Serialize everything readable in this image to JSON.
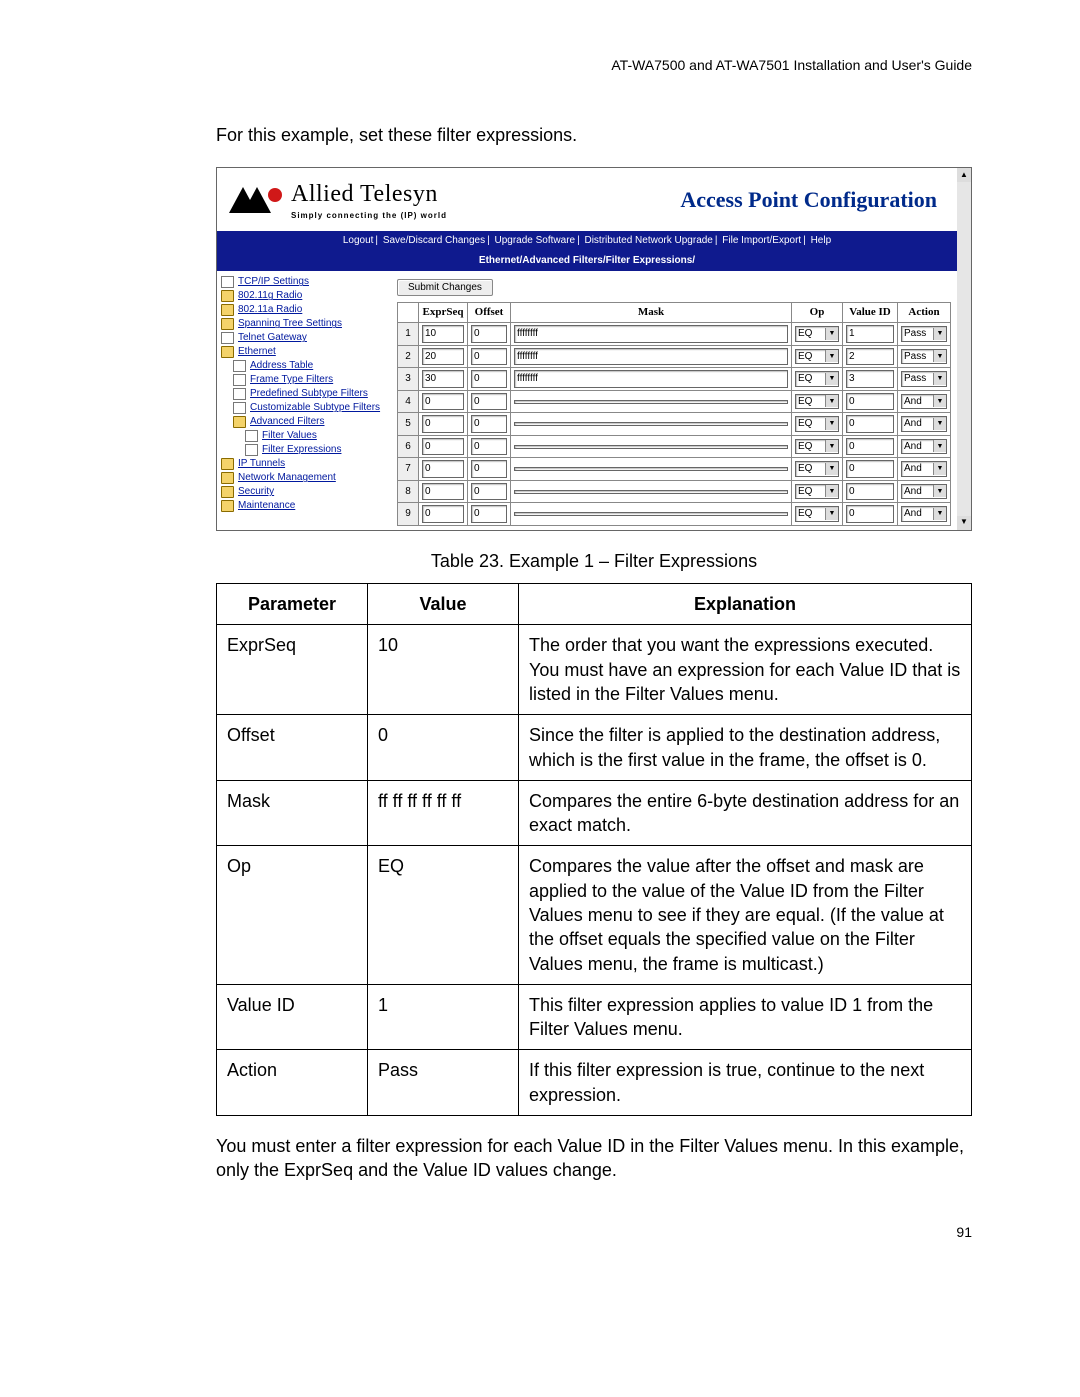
{
  "doc": {
    "running_head": "AT-WA7500 and AT-WA7501 Installation and User's Guide",
    "intro": "For this example, set these filter expressions.",
    "caption": "Table 23. Example 1 – Filter Expressions",
    "outro": "You must enter a filter expression for each Value ID in the Filter Values menu. In this example, only the ExprSeq and the Value ID values change.",
    "page_number": "91"
  },
  "screenshot": {
    "brand_name": "Allied Telesyn",
    "brand_tag": "Simply connecting the (IP) world",
    "title": "Access Point Configuration",
    "nav": {
      "links": [
        "Logout",
        "Save/Discard Changes",
        "Upgrade Software",
        "Distributed Network Upgrade",
        "File Import/Export",
        "Help"
      ],
      "breadcrumb": "Ethernet/Advanced Filters/Filter Expressions/"
    },
    "sidebar": [
      {
        "icon": "page",
        "label": "TCP/IP Settings",
        "indent": 0
      },
      {
        "icon": "folder",
        "label": "802.11g Radio",
        "indent": 0
      },
      {
        "icon": "folder",
        "label": "802.11a Radio",
        "indent": 0
      },
      {
        "icon": "folder",
        "label": "Spanning Tree Settings",
        "indent": 0
      },
      {
        "icon": "page",
        "label": "Telnet Gateway",
        "indent": 0
      },
      {
        "icon": "folder",
        "label": "Ethernet",
        "indent": 0
      },
      {
        "icon": "page",
        "label": "Address Table",
        "indent": 1
      },
      {
        "icon": "page",
        "label": "Frame Type Filters",
        "indent": 1
      },
      {
        "icon": "page",
        "label": "Predefined Subtype Filters",
        "indent": 1
      },
      {
        "icon": "page",
        "label": "Customizable Subtype Filters",
        "indent": 1
      },
      {
        "icon": "folder",
        "label": "Advanced Filters",
        "indent": 1
      },
      {
        "icon": "page",
        "label": "Filter Values",
        "indent": 2
      },
      {
        "icon": "page",
        "label": "Filter Expressions",
        "indent": 2
      },
      {
        "icon": "folder",
        "label": "IP Tunnels",
        "indent": 0
      },
      {
        "icon": "folder",
        "label": "Network Management",
        "indent": 0
      },
      {
        "icon": "folder",
        "label": "Security",
        "indent": 0
      },
      {
        "icon": "folder",
        "label": "Maintenance",
        "indent": 0
      }
    ],
    "submit_label": "Submit Changes",
    "columns": [
      "ExprSeq",
      "Offset",
      "Mask",
      "Op",
      "Value ID",
      "Action"
    ],
    "rows": [
      {
        "n": "1",
        "exprseq": "10",
        "offset": "0",
        "mask": "ffffffff",
        "op": "EQ",
        "value_id": "1",
        "action": "Pass"
      },
      {
        "n": "2",
        "exprseq": "20",
        "offset": "0",
        "mask": "ffffffff",
        "op": "EQ",
        "value_id": "2",
        "action": "Pass"
      },
      {
        "n": "3",
        "exprseq": "30",
        "offset": "0",
        "mask": "ffffffff",
        "op": "EQ",
        "value_id": "3",
        "action": "Pass"
      },
      {
        "n": "4",
        "exprseq": "0",
        "offset": "0",
        "mask": "",
        "op": "EQ",
        "value_id": "0",
        "action": "And"
      },
      {
        "n": "5",
        "exprseq": "0",
        "offset": "0",
        "mask": "",
        "op": "EQ",
        "value_id": "0",
        "action": "And"
      },
      {
        "n": "6",
        "exprseq": "0",
        "offset": "0",
        "mask": "",
        "op": "EQ",
        "value_id": "0",
        "action": "And"
      },
      {
        "n": "7",
        "exprseq": "0",
        "offset": "0",
        "mask": "",
        "op": "EQ",
        "value_id": "0",
        "action": "And"
      },
      {
        "n": "8",
        "exprseq": "0",
        "offset": "0",
        "mask": "",
        "op": "EQ",
        "value_id": "0",
        "action": "And"
      },
      {
        "n": "9",
        "exprseq": "0",
        "offset": "0",
        "mask": "",
        "op": "EQ",
        "value_id": "0",
        "action": "And"
      }
    ]
  },
  "def_table": {
    "headers": [
      "Parameter",
      "Value",
      "Explanation"
    ],
    "rows": [
      {
        "p": "ExprSeq",
        "v": "10",
        "e": "The order that you want the expressions executed. You must have an expression for each Value ID that is listed in the Filter Values menu."
      },
      {
        "p": "Offset",
        "v": "0",
        "e": "Since the filter is applied to the destination address, which is the first value in the frame, the offset is 0."
      },
      {
        "p": "Mask",
        "v": "ff ff ff ff ff ff",
        "e": "Compares the entire 6-byte destination address for an exact match."
      },
      {
        "p": "Op",
        "v": "EQ",
        "e": "Compares the value after the offset and mask are applied to the value of the Value ID from the Filter Values menu to see if they are equal. (If the value at the offset equals the specified value on the Filter Values menu, the frame is multicast.)"
      },
      {
        "p": "Value ID",
        "v": "1",
        "e": "This filter expression applies to value ID 1 from the Filter Values menu."
      },
      {
        "p": "Action",
        "v": "Pass",
        "e": "If this filter expression is true, continue to the next expression."
      }
    ]
  }
}
